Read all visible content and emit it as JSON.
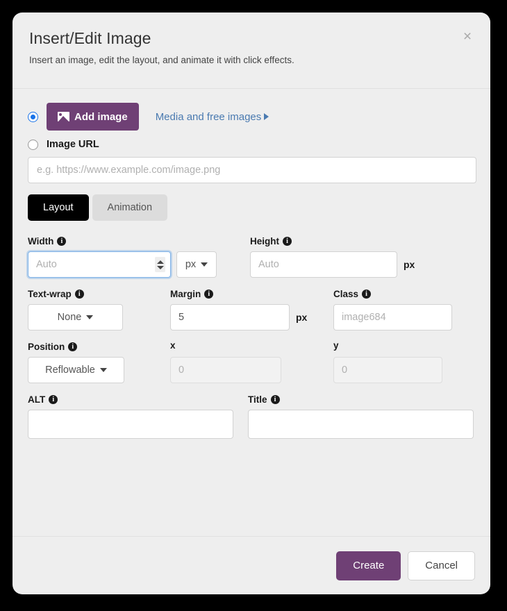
{
  "dialog": {
    "title": "Insert/Edit Image",
    "subtitle": "Insert an image, edit the layout, and animate it with click effects.",
    "close_label": "×"
  },
  "source": {
    "add_image_label": "Add image",
    "add_image_icon": "picture-icon",
    "media_link_label": "Media and free images",
    "media_link_arrow": "▶",
    "image_url_label": "Image URL",
    "url_placeholder": "e.g. https://www.example.com/image.png",
    "url_value": "",
    "selected_source": "add_image"
  },
  "tabs": [
    {
      "label": "Layout",
      "active": true
    },
    {
      "label": "Animation",
      "active": false
    }
  ],
  "fields": {
    "width": {
      "label": "Width",
      "info": "i",
      "placeholder": "Auto",
      "value": "",
      "unit_dropdown": "px"
    },
    "height": {
      "label": "Height",
      "info": "i",
      "placeholder": "Auto",
      "value": "",
      "unit": "px"
    },
    "text_wrap": {
      "label": "Text-wrap",
      "info": "i",
      "value": "None"
    },
    "margin": {
      "label": "Margin",
      "info": "i",
      "value": "5",
      "unit": "px"
    },
    "class": {
      "label": "Class",
      "info": "i",
      "placeholder": "image684",
      "value": ""
    },
    "position": {
      "label": "Position",
      "info": "i",
      "value": "Reflowable"
    },
    "x": {
      "label": "x",
      "placeholder": "0",
      "value": ""
    },
    "y": {
      "label": "y",
      "placeholder": "0",
      "value": ""
    },
    "alt": {
      "label": "ALT",
      "info": "i",
      "placeholder": "",
      "value": ""
    },
    "title": {
      "label": "Title",
      "info": "i",
      "placeholder": "",
      "value": ""
    }
  },
  "footer": {
    "create_label": "Create",
    "cancel_label": "Cancel"
  },
  "colors": {
    "accent_purple": "#6f4075",
    "link_blue": "#4a7ab0",
    "radio_blue": "#1a73e8",
    "tab_active_bg": "#000000",
    "dialog_bg": "#eeeeee",
    "page_bg": "#000000"
  }
}
